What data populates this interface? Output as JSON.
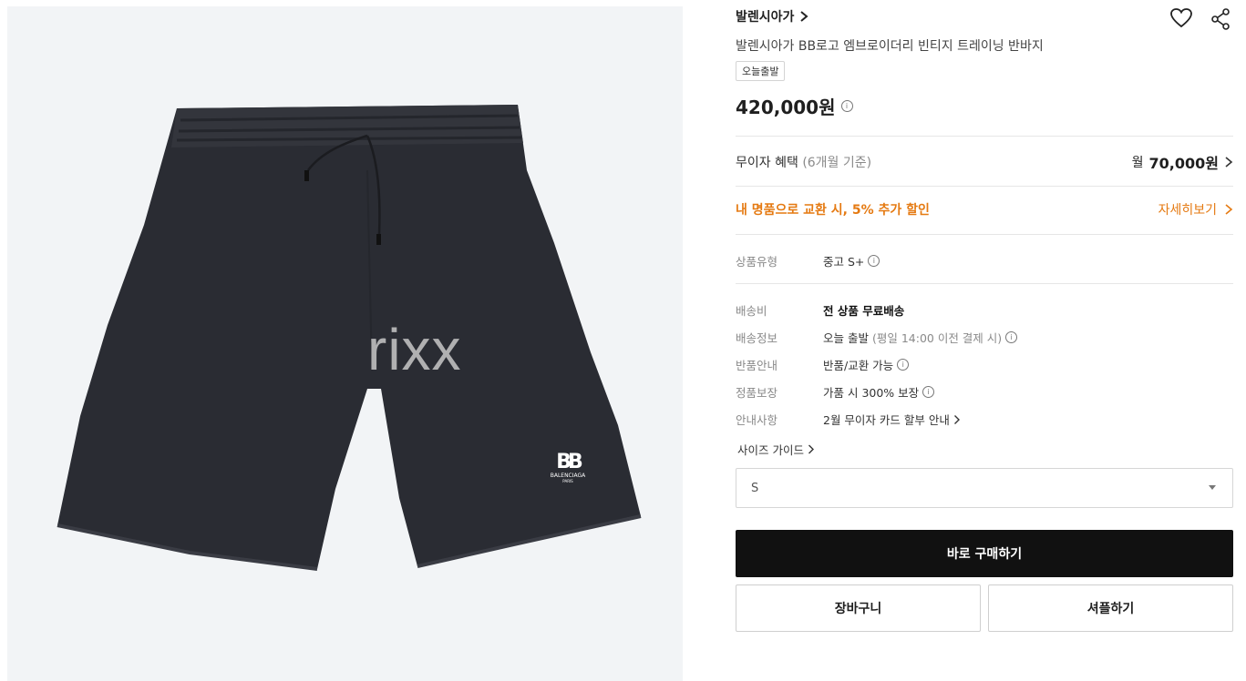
{
  "watermark": "rixx",
  "brand": {
    "name": "발렌시아가"
  },
  "product": {
    "title": "발렌시아가 BB로고 엠브로이더리 빈티지 트레이닝 반바지",
    "tag": "오늘출발",
    "price": "420,000원",
    "logo_text": "BALENCIAGA",
    "logo_sub": "PARIS"
  },
  "installment": {
    "label": "무이자 혜택",
    "period": "(6개월 기준)",
    "prefix": "월",
    "amount": "70,000원"
  },
  "exchange": {
    "label": "내 명품으로 교환 시, 5% 추가 할인",
    "link": "자세히보기"
  },
  "details": [
    {
      "key": "상품유형",
      "value": "중고 S+"
    },
    {
      "key": "배송비",
      "value": "전 상품 무료배송"
    },
    {
      "key": "배송정보",
      "value": "오늘 출발",
      "value_extra": "(평일 14:00 이전 결제 시)"
    },
    {
      "key": "반품안내",
      "value": "반품/교환 가능"
    },
    {
      "key": "정품보장",
      "value": "가품 시 300% 보장"
    },
    {
      "key": "안내사항",
      "value": "2월 무이자 카드 할부 안내"
    }
  ],
  "size_guide": "사이즈 가이드",
  "size_select": {
    "value": "S"
  },
  "buttons": {
    "buy": "바로 구매하기",
    "cart": "장바구니",
    "sell": "셔플하기"
  }
}
